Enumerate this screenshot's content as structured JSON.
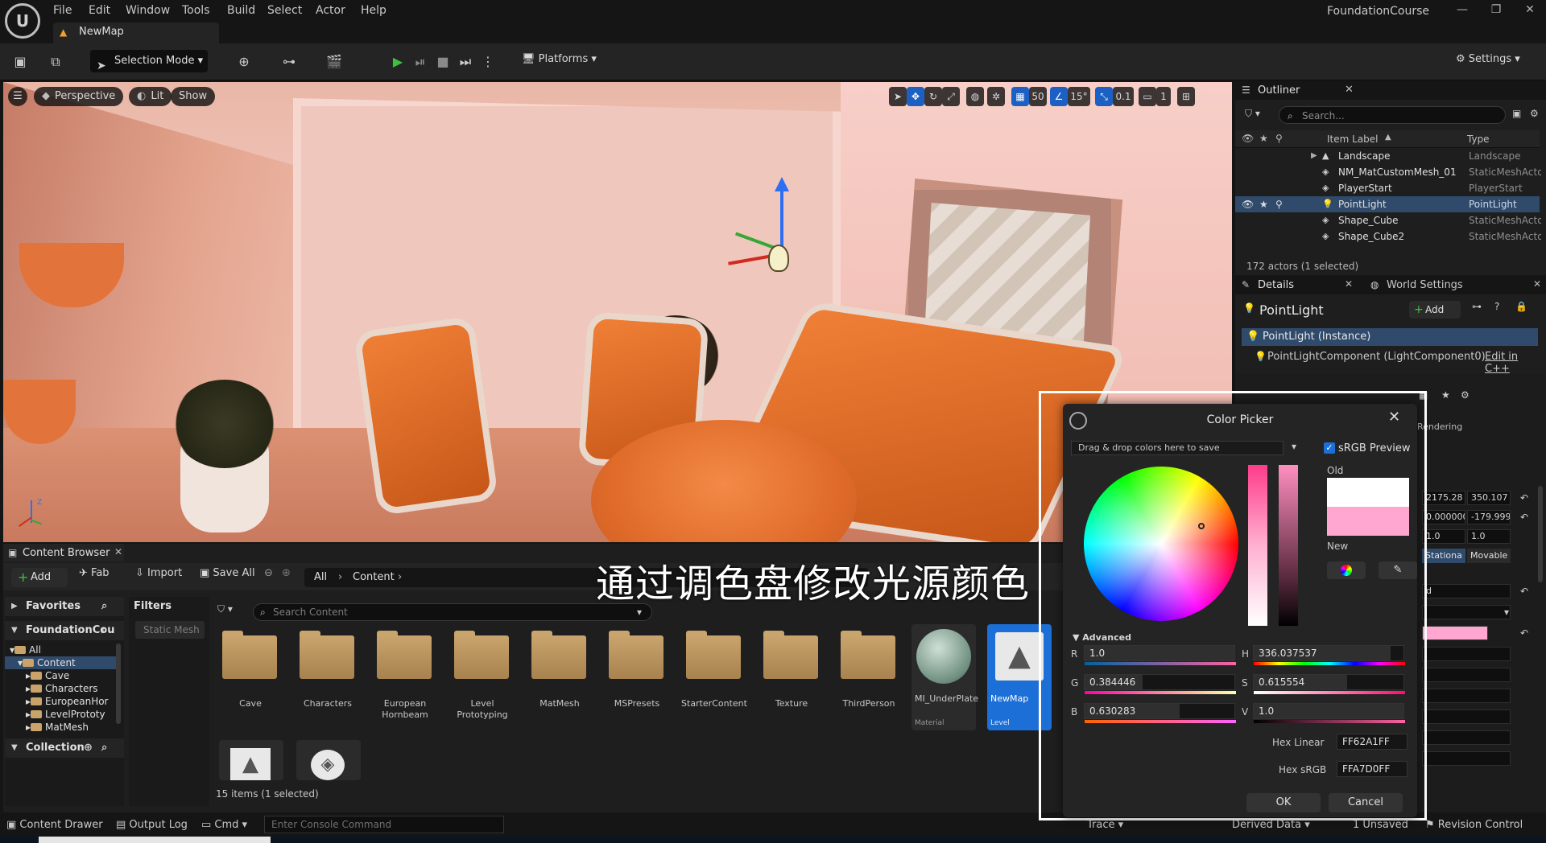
{
  "menu": [
    "File",
    "Edit",
    "Window",
    "Tools",
    "Build",
    "Select",
    "Actor",
    "Help"
  ],
  "project_name": "FoundationCourse",
  "level_tab": "NewMap",
  "toolbar": {
    "selection_mode": "Selection Mode",
    "platforms": "Platforms",
    "settings": "Settings"
  },
  "viewport": {
    "perspective": "Perspective",
    "lit": "Lit",
    "show": "Show",
    "grid_snap": "50",
    "rotation_snap": "15°",
    "scale_snap": "0.1",
    "camera_speed": "1",
    "axis_label": "Z"
  },
  "outliner": {
    "title": "Outliner",
    "search_placeholder": "Search...",
    "col_label": "Item Label",
    "col_type": "Type",
    "rows": [
      {
        "name": "Landscape",
        "type": "Landscape"
      },
      {
        "name": "NM_MatCustomMesh_01",
        "type": "StaticMeshActor"
      },
      {
        "name": "PlayerStart",
        "type": "PlayerStart"
      },
      {
        "name": "PointLight",
        "type": "PointLight"
      },
      {
        "name": "Shape_Cube",
        "type": "StaticMeshActor"
      },
      {
        "name": "Shape_Cube2",
        "type": "StaticMeshActor"
      }
    ],
    "status": "172 actors (1 selected)"
  },
  "details": {
    "tab_details": "Details",
    "tab_world": "World Settings",
    "title": "PointLight",
    "add": "Add",
    "instance": "PointLight (Instance)",
    "component": "PointLightComponent (LightComponent0)",
    "edit_cpp": "Edit in C++",
    "rendering": "Rendering",
    "loc": [
      "2175.28",
      "350.107"
    ],
    "rot": [
      "0.000000",
      "-179.999"
    ],
    "scale": [
      "1.0",
      "1.0"
    ],
    "mobility_stationary": "Stationa",
    "mobility_movable": "Movable",
    "field_d": "d"
  },
  "content_browser": {
    "tab": "Content Browser",
    "add": "Add",
    "fab": "Fab",
    "import": "Import",
    "save_all": "Save All",
    "path_all": "All",
    "path_content": "Content",
    "favorites": "Favorites",
    "project": "FoundationCou",
    "collection": "Collection",
    "filters": "Filters",
    "filter_chip": "Static Mesh",
    "search_placeholder": "Search Content",
    "tree": [
      "All",
      "Content",
      "Cave",
      "Characters",
      "EuropeanHor",
      "LevelPrototy",
      "MatMesh"
    ],
    "folders": [
      "Cave",
      "Characters",
      "European\nHornbeam",
      "Level\nPrototyping",
      "MatMesh",
      "MSPresets",
      "StarterContent",
      "Texture",
      "ThirdPerson"
    ],
    "material": {
      "name": "MI_UnderPlate",
      "sub": "Material"
    },
    "level": {
      "name": "NewMap",
      "sub": "Level"
    },
    "status": "15 items (1 selected)"
  },
  "subtitle": "通过调色盘修改光源颜色",
  "statusbar": {
    "content_drawer": "Content Drawer",
    "output_log": "Output Log",
    "cmd": "Cmd",
    "console_placeholder": "Enter Console Command",
    "trace": "Trace",
    "derived_data": "Derived Data",
    "unsaved": "1 Unsaved",
    "revision": "Revision Control"
  },
  "color_picker": {
    "title": "Color Picker",
    "drop_hint": "Drag & drop colors here to save",
    "srgb_preview": "sRGB Preview",
    "old_label": "Old",
    "new_label": "New",
    "new_color": "#ffa7d0",
    "advanced": "Advanced",
    "r_label": "R",
    "r": "1.0",
    "g_label": "G",
    "g": "0.384446",
    "b_label": "B",
    "b": "0.630283",
    "h_label": "H",
    "h": "336.037537",
    "s_label": "S",
    "s": "0.615554",
    "v_label": "V",
    "v": "1.0",
    "hex_linear_label": "Hex Linear",
    "hex_linear": "FF62A1FF",
    "hex_srgb_label": "Hex sRGB",
    "hex_srgb": "FFA7D0FF",
    "ok": "OK",
    "cancel": "Cancel"
  }
}
